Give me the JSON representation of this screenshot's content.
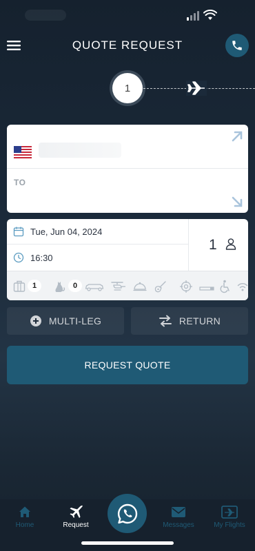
{
  "header": {
    "title": "QUOTE REQUEST"
  },
  "progress": {
    "current_step": "1"
  },
  "route": {
    "to_label": "TO"
  },
  "details": {
    "date": "Tue, Jun 04, 2024",
    "time": "16:30",
    "passengers": "1"
  },
  "amenities": {
    "luggage_count": "1",
    "pets_count": "0",
    "icons": [
      "luggage-icon",
      "pet-icon",
      "limousine-icon",
      "helicopter-icon",
      "catering-icon",
      "guitar-icon",
      "hunting-icon",
      "smoking-icon",
      "wheelchair-icon",
      "wifi-icon"
    ]
  },
  "actions": {
    "multi_leg": "MULTI-LEG",
    "return": "RETURN",
    "request_quote": "REQUEST QUOTE"
  },
  "tabbar": {
    "home": "Home",
    "request": "Request",
    "messages": "Messages",
    "my_flights": "My Flights"
  },
  "colors": {
    "accent": "#1f5a75",
    "background": "#1b2a3a",
    "tab_inactive": "#1f5a75",
    "tab_active": "#ffffff"
  }
}
